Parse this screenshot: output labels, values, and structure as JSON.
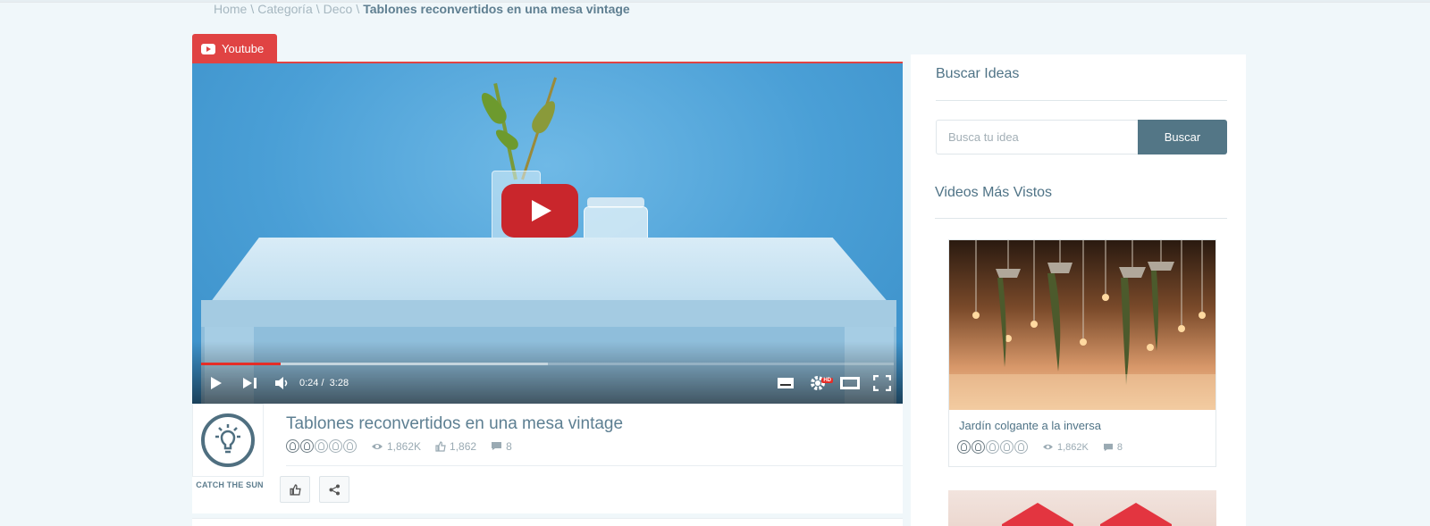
{
  "breadcrumb": {
    "items": [
      "Home",
      "Categoría",
      "Deco"
    ],
    "separator": "\\",
    "current": "Tablones reconvertidos en una mesa vintage"
  },
  "source_tab": {
    "label": "Youtube",
    "icon": "youtube-icon",
    "color": "#e04343"
  },
  "player": {
    "current_time": "0:24",
    "time_separator": "/",
    "duration": "3:28",
    "played_fraction": 0.115,
    "buffered_fraction": 0.5,
    "hd_badge": "HD",
    "icons": [
      "play-icon",
      "next-icon",
      "volume-icon",
      "subtitles-icon",
      "settings-icon",
      "theater-mode-icon",
      "fullscreen-icon"
    ],
    "accent": "#e52d27"
  },
  "video": {
    "channel_name": "CATCH THE SUN",
    "title": "Tablones reconvertidos en una mesa vintage",
    "rating": 2,
    "rating_max": 5,
    "views": "1,862K",
    "likes": "1,862",
    "comments": "8"
  },
  "sidebar": {
    "search": {
      "heading": "Buscar Ideas",
      "placeholder": "Busca tu idea",
      "button_label": "Buscar"
    },
    "popular": {
      "heading": "Videos Más Vistos",
      "items": [
        {
          "title": "Jardín colgante a la inversa",
          "rating": 2,
          "views": "1,862K",
          "comments": "8"
        }
      ]
    }
  },
  "colors": {
    "page_bg": "#f0f7fa",
    "brand": "#537686",
    "text": "#4f7386"
  }
}
